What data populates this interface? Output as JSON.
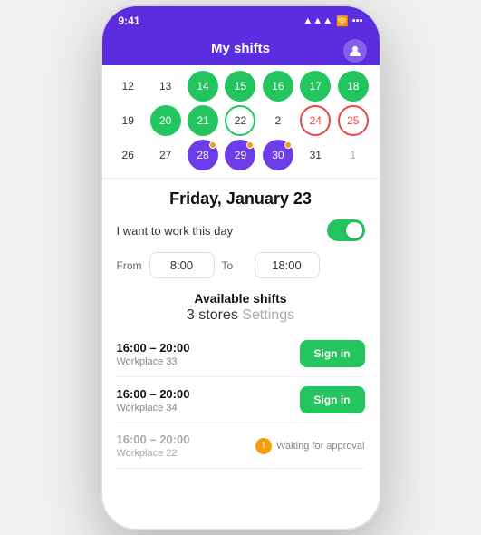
{
  "statusBar": {
    "time": "9:41",
    "signal": "▲▲▲",
    "wifi": "WiFi",
    "battery": "🔋"
  },
  "header": {
    "title": "My shifts"
  },
  "calendar": {
    "rows": [
      [
        {
          "label": "12",
          "style": "default"
        },
        {
          "label": "13",
          "style": "default"
        },
        {
          "label": "14",
          "style": "green-filled"
        },
        {
          "label": "15",
          "style": "green-filled"
        },
        {
          "label": "16",
          "style": "green-filled"
        },
        {
          "label": "17",
          "style": "green-filled"
        },
        {
          "label": "18",
          "style": "green-filled"
        }
      ],
      [
        {
          "label": "19",
          "style": "default"
        },
        {
          "label": "20",
          "style": "green-filled"
        },
        {
          "label": "21",
          "style": "green-filled"
        },
        {
          "label": "22",
          "style": "selected-outline"
        },
        {
          "label": "2",
          "style": "default"
        },
        {
          "label": "24",
          "style": "red-outline"
        },
        {
          "label": "25",
          "style": "red-outline"
        }
      ],
      [
        {
          "label": "26",
          "style": "default"
        },
        {
          "label": "27",
          "style": "default"
        },
        {
          "label": "28",
          "style": "purple-filled",
          "dot": true
        },
        {
          "label": "29",
          "style": "purple-filled",
          "dot": true
        },
        {
          "label": "30",
          "style": "purple-filled",
          "dot": true
        },
        {
          "label": "31",
          "style": "default"
        },
        {
          "label": "1",
          "style": "light"
        }
      ]
    ]
  },
  "dateTitle": "Friday, January 23",
  "workToggle": {
    "label": "I want to work this day",
    "enabled": true
  },
  "timeRange": {
    "fromLabel": "From",
    "fromValue": "8:00",
    "toLabel": "To",
    "toValue": "18:00"
  },
  "availableShifts": {
    "title": "Available shifts",
    "storesLabel": "3 stores",
    "settingsLabel": "Settings",
    "shifts": [
      {
        "time": "16:00 – 20:00",
        "workplace": "Workplace 33",
        "action": "signin"
      },
      {
        "time": "16:00 – 20:00",
        "workplace": "Workplace 34",
        "action": "signin"
      },
      {
        "time": "16:00 – 20:00",
        "workplace": "Workplace 22",
        "action": "waiting"
      }
    ],
    "signInLabel": "Sign in",
    "waitingLabel": "Waiting for approval"
  }
}
